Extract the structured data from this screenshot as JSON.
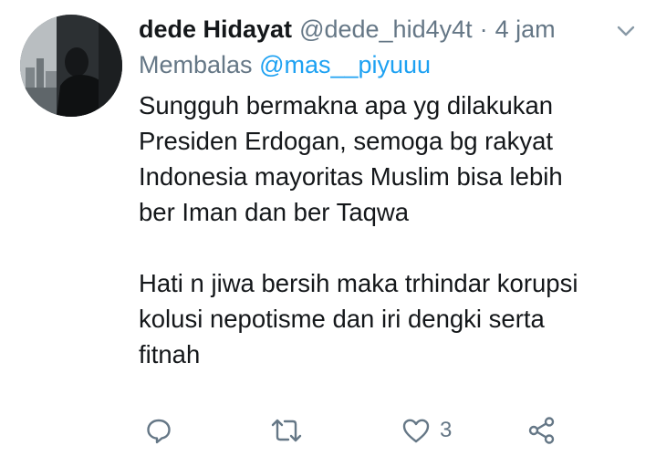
{
  "tweet": {
    "display_name": "dede Hidayat",
    "handle": "@dede_hid4y4t",
    "separator": "·",
    "time": "4 jam",
    "reply_prefix": "Membalas",
    "reply_to": "@mas__piyuuu",
    "text_lines_1": [
      "Sungguh bermakna apa yg dilakukan",
      "Presiden Erdogan,  semoga bg rakyat",
      "Indonesia mayoritas Muslim bisa lebih",
      "ber Iman dan ber Taqwa"
    ],
    "text_lines_2": [
      "Hati n jiwa bersih maka trhindar korupsi",
      "kolusi nepotisme dan iri dengki serta",
      "fitnah"
    ],
    "like_count": "3"
  },
  "icons": {
    "caret": "chevron-down-icon",
    "reply": "reply-icon",
    "retweet": "retweet-icon",
    "like": "heart-icon",
    "share": "share-icon"
  },
  "colors": {
    "text": "#14171a",
    "secondary": "#657786",
    "link": "#1da1f2"
  }
}
